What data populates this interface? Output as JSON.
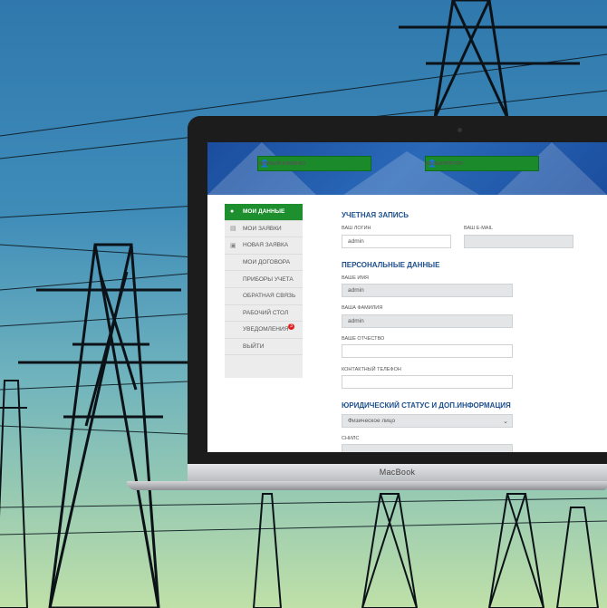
{
  "laptop": {
    "brand": "MacBook"
  },
  "header": {
    "cabinet_label": "ЛИЧНЫЙ КАБИНЕТ",
    "calculator_label": "КАЛЬКУЛЯТОР"
  },
  "sidebar": {
    "items": [
      {
        "label": "МОИ ДАННЫЕ"
      },
      {
        "label": "МОИ ЗАЯВКИ"
      },
      {
        "label": "НОВАЯ ЗАЯВКА"
      },
      {
        "label": "МОИ ДОГОВОРА"
      },
      {
        "label": "ПРИБОРЫ УЧЕТА"
      },
      {
        "label": "ОБРАТНАЯ СВЯЗЬ"
      },
      {
        "label": "РАБОЧИЙ СТОЛ"
      },
      {
        "label": "УВЕДОМЛЕНИЯ",
        "badge": "3"
      },
      {
        "label": "ВЫЙТИ"
      }
    ]
  },
  "account": {
    "title": "УЧЕТНАЯ ЗАПИСЬ",
    "login_label": "ВАШ ЛОГИН",
    "login_value": "admin",
    "email_label": "ВАШ E-MAIL",
    "email_value": ""
  },
  "personal": {
    "title": "ПЕРСОНАЛЬНЫЕ ДАННЫЕ",
    "name_label": "ВАШЕ ИМЯ",
    "name_value": "admin",
    "surname_label": "ВАША ФАМИЛИЯ",
    "surname_value": "admin",
    "patronymic_label": "ВАШЕ ОТЧЕСТВО",
    "patronymic_value": "",
    "phone_label": "КОНТАКТНЫЙ ТЕЛЕФОН",
    "phone_value": ""
  },
  "legal": {
    "title": "ЮРИДИЧЕСКИЙ СТАТУС И ДОП.ИНФОРМАЦИЯ",
    "status_value": "Физическое лицо",
    "snils_label": "СНИЛС"
  }
}
